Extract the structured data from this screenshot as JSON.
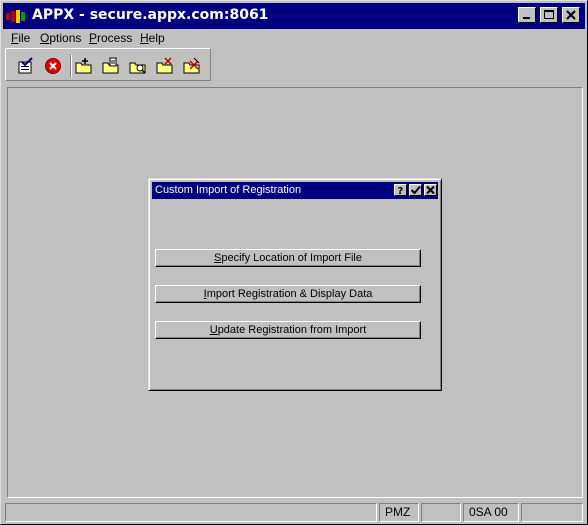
{
  "window": {
    "title": "APPX - secure.appx.com:8061",
    "controls": [
      "minimize-icon",
      "maximize-icon",
      "close-icon"
    ]
  },
  "menubar": {
    "items": [
      {
        "label": "File",
        "accel": "F",
        "rest": "ile"
      },
      {
        "label": "Options",
        "accel": "O",
        "rest": "ptions"
      },
      {
        "label": "Process",
        "accel": "P",
        "rest": "rocess"
      },
      {
        "label": "Help",
        "accel": "H",
        "rest": "elp"
      }
    ]
  },
  "toolbar": {
    "icons": [
      "ok-check-icon",
      "cancel-icon",
      "add-folder-icon",
      "change-folder-icon",
      "inquire-folder-icon",
      "delete-folder-icon",
      "remove-folder-icon"
    ]
  },
  "dialog": {
    "title": "Custom Import of Registration",
    "controls": [
      "help-icon",
      "checkmark-icon",
      "close-icon"
    ],
    "buttons": [
      {
        "accel": "S",
        "rest": "pecify Location of Import File"
      },
      {
        "accel": "I",
        "rest": "mport Registration & Display Data"
      },
      {
        "accel": "U",
        "rest": "pdate Registration from Import"
      }
    ]
  },
  "statusbar": {
    "cells": [
      "",
      "PMZ",
      "",
      "0SA 00",
      ""
    ]
  },
  "colors": {
    "titlebar": "#000080",
    "face": "#c0c0c0"
  }
}
